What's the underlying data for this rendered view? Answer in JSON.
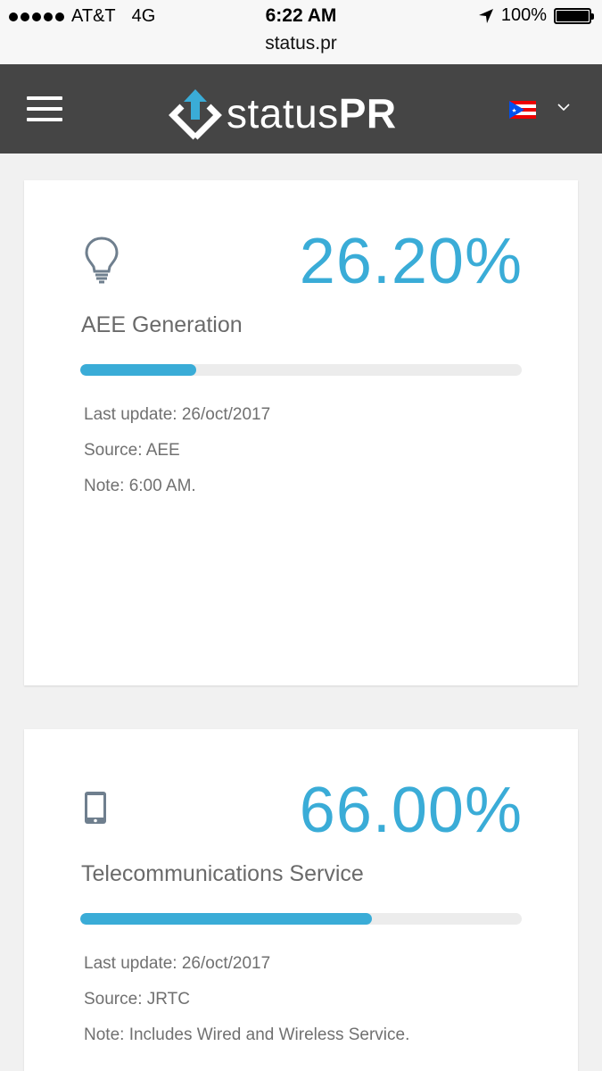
{
  "status_bar": {
    "carrier": "AT&T",
    "network": "4G",
    "time": "6:22 AM",
    "battery": "100%",
    "url": "status.pr"
  },
  "header": {
    "logo_text_light": "status",
    "logo_text_bold": "PR",
    "menu_icon": "hamburger-icon",
    "language_flag": "puerto-rico-flag",
    "language_icon": "chevron-down-icon"
  },
  "colors": {
    "accent": "#3aacd7",
    "header_bg": "#454545",
    "page_bg": "#f1f1f1"
  },
  "cards": [
    {
      "icon": "lightbulb-icon",
      "percent": "26.20%",
      "progress": 0.262,
      "title": "AEE Generation",
      "last_update": "Last update: 26/oct/2017",
      "source": "Source: AEE",
      "note": "Note: 6:00 AM."
    },
    {
      "icon": "mobile-phone-icon",
      "percent": "66.00%",
      "progress": 0.66,
      "title": "Telecommunications Service",
      "last_update": "Last update: 26/oct/2017",
      "source": "Source: JRTC",
      "note": "Note: Includes Wired and Wireless Service."
    }
  ]
}
